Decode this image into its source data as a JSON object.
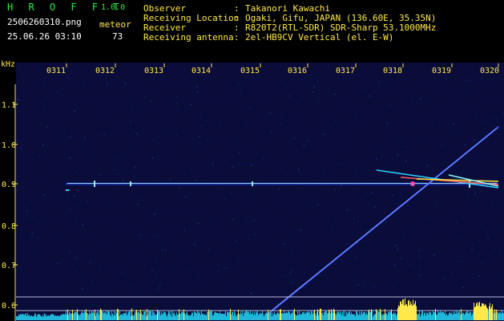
{
  "app": {
    "title": "H R O F F T",
    "version": "1.0.0"
  },
  "header": {
    "filename": "2506260310.png",
    "datetime": "25.06.26 03:10",
    "meteor_label": "meteor",
    "meteor_count": "73"
  },
  "info": [
    {
      "label": "Observer",
      "value": "Takanori Kawachi"
    },
    {
      "label": "Receiving Location",
      "value": "Ogaki, Gifu, JAPAN (136.60E, 35.35N)"
    },
    {
      "label": "Receiver",
      "value": "R820T2(RTL-SDR) SDR-Sharp 53.1000MHz"
    },
    {
      "label": "Receiving antenna",
      "value": "2el-HB9CV Vertical (el. E-W)"
    }
  ],
  "axis": {
    "unit": "kHz",
    "time_ticks": [
      "0311",
      "0312",
      "0313",
      "0314",
      "0315",
      "0316",
      "0317",
      "0318",
      "0319",
      "0320"
    ],
    "freq_ticks": [
      "1.1",
      "1.0",
      "0.9",
      "0.8",
      "0.7",
      "0.6"
    ]
  },
  "colors": {
    "background": "#000000",
    "plot_background": "#0a0c3a",
    "carrier": "#7ff0ff",
    "label": "#ffe94a",
    "title": "#2ee84a",
    "signal_strength_bars": "#21b7d8",
    "signal_peaks": "#ffe94a"
  }
}
